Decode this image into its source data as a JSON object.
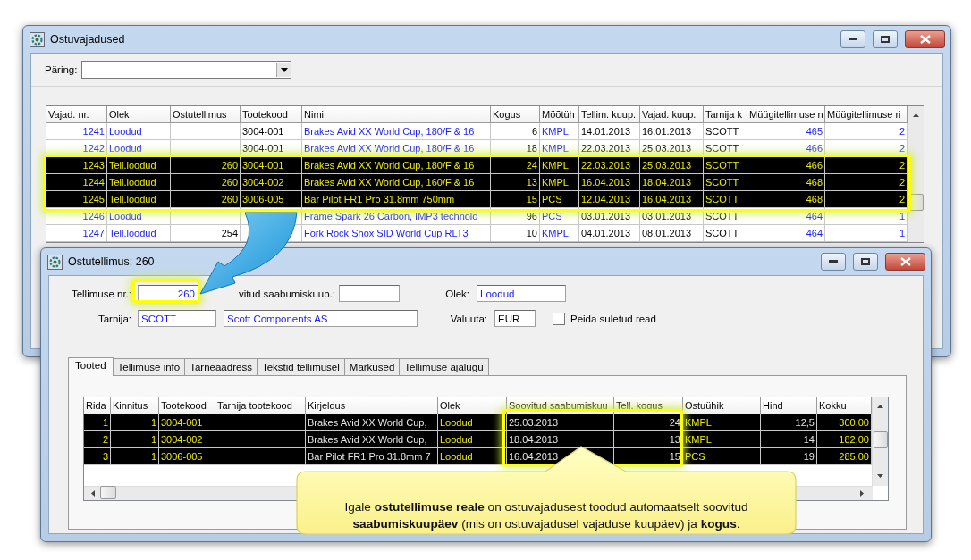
{
  "main_window": {
    "title": "Ostuvajadused",
    "query_label": "Päring:",
    "table": {
      "columns": [
        {
          "label": "Vajad. nr.",
          "link": true
        },
        {
          "label": "Olek",
          "link": true
        },
        {
          "label": "Ostutellimus"
        },
        {
          "label": "Tootekood"
        },
        {
          "label": "Nimi",
          "link": true
        },
        {
          "label": "Kogus"
        },
        {
          "label": "Mõõtüh",
          "link": true
        },
        {
          "label": "Tellim. kuup."
        },
        {
          "label": "Vajad. kuup."
        },
        {
          "label": "Tarnija k"
        },
        {
          "label": "Müügitellimuse n",
          "link": true
        },
        {
          "label": "Müügitellimuse ri",
          "link": true
        }
      ],
      "rows": [
        {
          "selected": false,
          "cells": [
            "1241",
            "Loodud",
            null,
            "3004-001",
            "Brakes Avid XX World Cup, 180/F & 16",
            "6",
            "KMPL",
            "14.01.2013",
            "16.01.2013",
            "SCOTT",
            "465",
            "2"
          ]
        },
        {
          "selected": false,
          "cells": [
            "1242",
            "Loodud",
            null,
            "3004-001",
            "Brakes Avid XX World Cup, 180/F & 16",
            "18",
            "KMPL",
            "22.03.2013",
            "25.03.2013",
            "SCOTT",
            "466",
            "2"
          ]
        },
        {
          "selected": true,
          "cells": [
            "1243",
            "Tell.loodud",
            "260",
            "3004-001",
            "Brakes Avid XX World Cup, 180/F & 16",
            "24",
            "KMPL",
            "22.03.2013",
            "25.03.2013",
            "SCOTT",
            "466",
            "2"
          ]
        },
        {
          "selected": true,
          "cells": [
            "1244",
            "Tell.loodud",
            "260",
            "3004-002",
            "Brakes Avid XX World Cup, 160/F & 16",
            "13",
            "KMPL",
            "16.04.2013",
            "18.04.2013",
            "SCOTT",
            "468",
            "2"
          ]
        },
        {
          "selected": true,
          "cells": [
            "1245",
            "Tell.loodud",
            "260",
            "3006-005",
            "Bar Pilot FR1 Pro 31.8mm 750mm",
            "15",
            "PCS",
            "12.04.2013",
            "16.04.2013",
            "SCOTT",
            "468",
            "2"
          ]
        },
        {
          "selected": false,
          "cells": [
            "1246",
            "Loodud",
            null,
            null,
            "Frame Spark 26 Carbon, IMP3 technolo",
            "96",
            "PCS",
            "03.01.2013",
            "03.01.2013",
            "SCOTT",
            "464",
            "1"
          ]
        },
        {
          "selected": false,
          "cells": [
            "1247",
            "Tell.loodud",
            "254",
            null,
            "Fork Rock Shox SID World Cup RLT3",
            "10",
            "KMPL",
            "04.01.2013",
            "08.01.2013",
            "SCOTT",
            "464",
            "1"
          ]
        }
      ]
    }
  },
  "order_window": {
    "title": "Ostutellimus: 260",
    "order_no": {
      "label": "Tellimuse nr.:",
      "value": "260"
    },
    "arrival": {
      "label": "vitud saabumiskuup.:"
    },
    "status": {
      "label": "Olek:",
      "value": "Loodud"
    },
    "supplier": {
      "label": "Tarnija:",
      "code": "SCOTT",
      "name": "Scott Components AS"
    },
    "currency": {
      "label": "Valuuta:",
      "value": "EUR"
    },
    "hide_closed": {
      "label": "Peida suletud read",
      "checked": false
    },
    "tabs": [
      {
        "label": "Tooted",
        "selected": true
      },
      {
        "label": "Tellimuse info",
        "selected": false
      },
      {
        "label": "Tarneaadress",
        "selected": false
      },
      {
        "label": "Tekstid tellimusel",
        "selected": false
      },
      {
        "label": "Märkused",
        "selected": false
      },
      {
        "label": "Tellimuse ajalugu",
        "selected": false
      }
    ],
    "table": {
      "columns": [
        {
          "label": "Rida"
        },
        {
          "label": "Kinnitus"
        },
        {
          "label": "Tootekood"
        },
        {
          "label": "Tarnija tootekood"
        },
        {
          "label": "Kirjeldus",
          "light": true
        },
        {
          "label": "Olek"
        },
        {
          "label": "Soovitud saabumiskuu",
          "light": true
        },
        {
          "label": "Tell. kogus",
          "light": true
        },
        {
          "label": "Ostuühik"
        },
        {
          "label": "Hind",
          "light": true
        },
        {
          "label": "Kokku"
        }
      ],
      "rows": [
        {
          "selected": true,
          "cells": [
            "1",
            "1",
            "3004-001",
            null,
            "Brakes Avid XX World Cup,",
            "Loodud",
            "25.03.2013",
            "24",
            "KMPL",
            "12,5",
            "300,00"
          ]
        },
        {
          "selected": true,
          "cells": [
            "2",
            "1",
            "3004-002",
            null,
            "Brakes Avid XX World Cup,",
            "Loodud",
            "18.04.2013",
            "13",
            "KMPL",
            "14",
            "182,00"
          ]
        },
        {
          "selected": true,
          "cells": [
            "3",
            "1",
            "3006-005",
            null,
            "Bar Pilot FR1 Pro 31.8mm 7",
            "Loodud",
            "16.04.2013",
            "15",
            "PCS",
            "19",
            "285,00"
          ]
        }
      ]
    }
  },
  "callout": "Igale **ostutellimuse reale** on ostuvajadusest toodud automaatselt soovitud **saabumiskuupäev** (mis on ostuvajadusel vajaduse kuupäev) ja **kogus**."
}
